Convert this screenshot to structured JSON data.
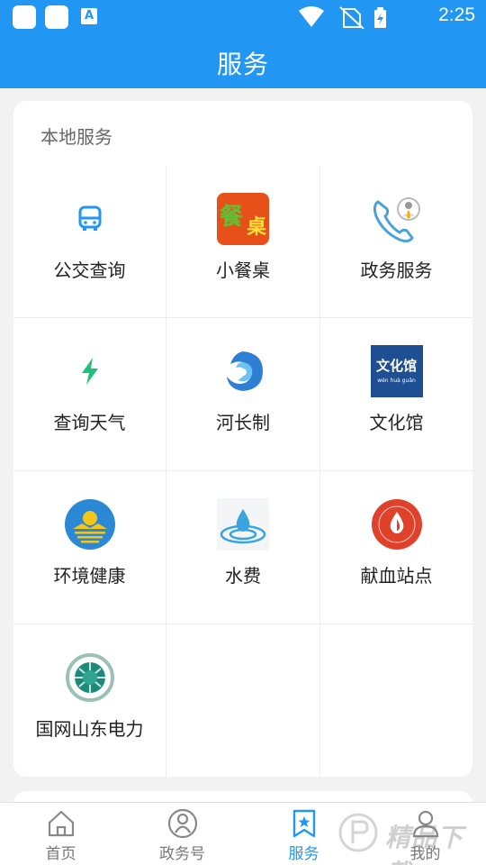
{
  "status_bar": {
    "time": "2:25",
    "app_badge": "A"
  },
  "header": {
    "title": "服务"
  },
  "local_services": {
    "section_title": "本地服务",
    "items": [
      {
        "label": "公交查询",
        "icon": "bus-icon"
      },
      {
        "label": "小餐桌",
        "icon": "small-dining-table-app-icon",
        "icon_text_1": "餐",
        "icon_text_2": "桌"
      },
      {
        "label": "政务服务",
        "icon": "government-phone-icon"
      },
      {
        "label": "查询天气",
        "icon": "lightning-icon"
      },
      {
        "label": "河长制",
        "icon": "river-swirl-icon"
      },
      {
        "label": "文化馆",
        "icon": "culture-hall-logo-icon",
        "icon_text": "文化馆",
        "icon_subtext": "wén huà guǎn"
      },
      {
        "label": "环境健康",
        "icon": "sun-water-icon"
      },
      {
        "label": "水费",
        "icon": "water-drop-icon"
      },
      {
        "label": "献血站点",
        "icon": "blood-donation-icon"
      },
      {
        "label": "国网山东电力",
        "icon": "state-grid-logo-icon"
      }
    ]
  },
  "bottom_nav": {
    "tabs": [
      {
        "label": "首页",
        "icon": "home-icon",
        "active": false
      },
      {
        "label": "政务号",
        "icon": "government-account-icon",
        "active": false
      },
      {
        "label": "服务",
        "icon": "bookmark-star-icon",
        "active": true
      },
      {
        "label": "我的",
        "icon": "user-icon",
        "active": false
      }
    ]
  },
  "watermark": {
    "text": "精品下载"
  },
  "colors": {
    "primary": "#2196f3",
    "background": "#f2f2f2",
    "card": "#ffffff"
  }
}
